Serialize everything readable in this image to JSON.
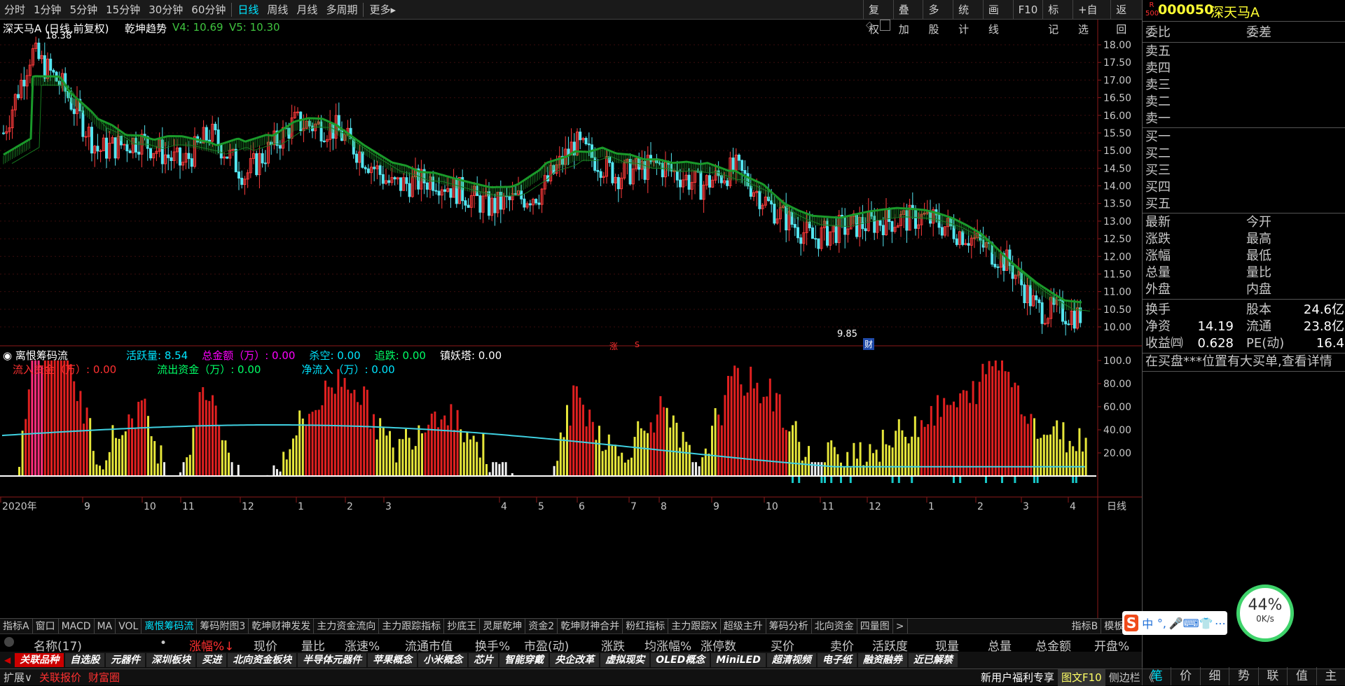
{
  "toolbar": {
    "left": [
      "分时",
      "1分钟",
      "5分钟",
      "15分钟",
      "30分钟",
      "60分钟",
      "日线",
      "周线",
      "月线",
      "多周期",
      "更多▸"
    ],
    "active_index": 6,
    "right": [
      "复权",
      "叠加",
      "多股",
      "统计",
      "画线",
      "F10",
      "标记",
      "+自选",
      "返回"
    ]
  },
  "stock": {
    "code": "000050",
    "name": "深天马A",
    "flag": "R"
  },
  "main_chart": {
    "header_name": "深天马A (日线,前复权)",
    "indicator_name": "乾坤趋势",
    "v4_label": "V4: 10.69",
    "v5_label": "V5: 10.30",
    "max_price_label": "18.38",
    "min_price_label": "9.85",
    "marker_zhang": "涨",
    "marker_s": "S",
    "marker_cai": "财",
    "price_axis": [
      "18.00",
      "17.50",
      "17.00",
      "16.50",
      "16.00",
      "15.50",
      "15.00",
      "14.50",
      "14.00",
      "13.50",
      "13.00",
      "12.50",
      "12.00",
      "11.50",
      "11.00",
      "10.50",
      "10.00"
    ]
  },
  "sub_chart": {
    "name": "离恨筹码流",
    "row1": [
      {
        "text": "活跃量: 8.54",
        "color": "#00e5ff"
      },
      {
        "text": "总金额（万）: 0.00",
        "color": "#ff00ff"
      },
      {
        "text": "杀空: 0.00",
        "color": "#00e5ff"
      },
      {
        "text": "追跌: 0.00",
        "color": "#00ff66"
      },
      {
        "text": "镇妖塔: 0.00",
        "color": "#ffffff"
      }
    ],
    "row2": [
      {
        "text": "流入资金（万）:  0.00",
        "color": "#ff3030"
      },
      {
        "text": "流出资金（万）:  0.00",
        "color": "#00ff66"
      },
      {
        "text": "净流入（万）:  0.00",
        "color": "#00e5ff"
      }
    ],
    "axis": [
      "100.0",
      "80.00",
      "60.00",
      "40.00",
      "20.00"
    ]
  },
  "date_axis": [
    "2020年",
    "9",
    "10",
    "11",
    "12",
    "1",
    "2",
    "3",
    "4",
    "5",
    "6",
    "7",
    "8",
    "9",
    "10",
    "11",
    "12",
    "1",
    "2",
    "3",
    "4"
  ],
  "date_axis_end": "日线",
  "indicator_tabs": [
    "指标A",
    "窗口",
    "MACD",
    "MA",
    "VOL",
    "离恨筹码流",
    "筹码附图3",
    "乾坤财神发发",
    "主力资金流向",
    "主力跟踪指标",
    "抄底王",
    "灵犀乾坤",
    "资金2",
    "乾坤财神合并",
    "粉红指标",
    "主力跟踪X",
    "超级主升",
    "筹码分析",
    "北向资金",
    "四量图",
    ">"
  ],
  "indicator_tabs_right": [
    "指标B",
    "模板",
    "+"
  ],
  "indicator_active": 5,
  "columns": [
    "名称(17)",
    "•",
    "涨幅%↓",
    "现价",
    "量比",
    "涨速%",
    "流通市值",
    "换手%",
    "市盈(动)",
    "涨跌",
    "均涨幅%",
    "涨停数",
    "买价",
    "卖价",
    "活跃度",
    "现量",
    "总量",
    "总金额",
    "开盘%"
  ],
  "sections": [
    "关联品种",
    "自选股",
    "元器件",
    "深圳板块",
    "买进",
    "北向资金板块",
    "半导体元器件",
    "苹果概念",
    "小米概念",
    "芯片",
    "智能穿戴",
    "央企改革",
    "虚拟现实",
    "OLED概念",
    "MiniLED",
    "超清视频",
    "电子纸",
    "融资融券",
    "近已解禁"
  ],
  "bottom": {
    "left": [
      "扩展∨",
      "关联报价",
      "财富圈"
    ],
    "right_text": "新用户福利专享",
    "f10": "图文F10",
    "side": "侧边栏 《"
  },
  "right_panel": {
    "weibi": "委比",
    "weicha": "委差",
    "sells": [
      "卖五",
      "卖四",
      "卖三",
      "卖二",
      "卖一"
    ],
    "buys": [
      "买一",
      "买二",
      "买三",
      "买四",
      "买五"
    ],
    "stats_left": [
      "最新",
      "涨跌",
      "涨幅",
      "总量",
      "外盘"
    ],
    "stats_right": [
      "今开",
      "最高",
      "最低",
      "量比",
      "内盘"
    ],
    "hs": {
      "l1": "换手",
      "l2": "股本",
      "v2": "24.6亿"
    },
    "jz": {
      "l1": "净资",
      "v1": "14.19",
      "l2": "流通",
      "v2": "23.8亿"
    },
    "sy": {
      "l1": "收益㈣",
      "v1": "0.628",
      "l2": "PE(动)",
      "v2": "16.4"
    },
    "notice": "在买盘***位置有大买单,查看详情",
    "tabs": [
      "笔",
      "价",
      "细",
      "势",
      "联",
      "值",
      "主"
    ]
  },
  "speed": {
    "percent": "44%",
    "rate": "0K/s"
  },
  "ime": {
    "chars": [
      "S",
      "中",
      "°,",
      "🎤",
      "⌨",
      "👕",
      "⋯"
    ]
  }
}
